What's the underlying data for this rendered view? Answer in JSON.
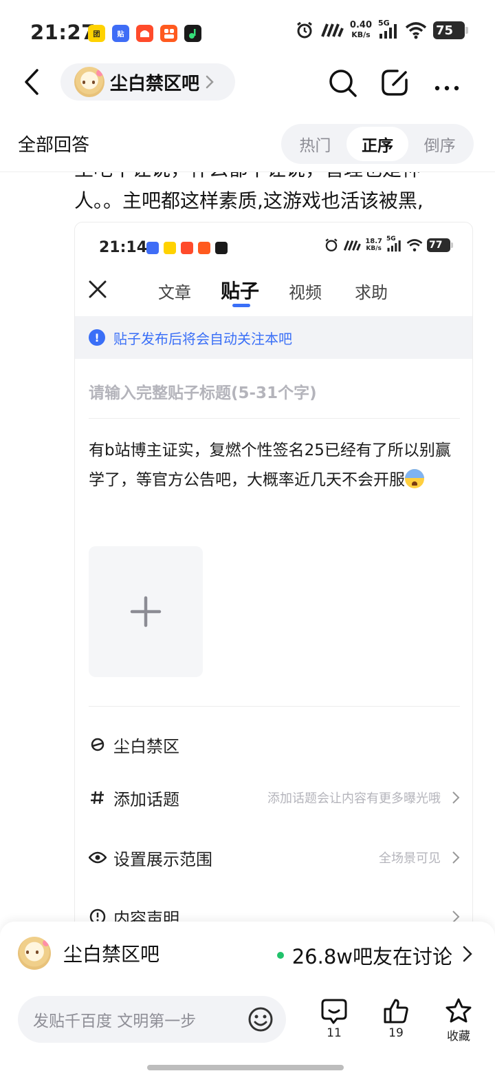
{
  "status_bar": {
    "time": "21:27",
    "net_speed_value": "0.40",
    "net_speed_unit": "KB/s",
    "network": "5G",
    "battery": "75",
    "apps": [
      {
        "name": "group-buy-app-icon",
        "color": "#ffd200",
        "glyph": "团"
      },
      {
        "name": "tieba-app-icon",
        "color": "#3f6df6",
        "glyph": "贴"
      },
      {
        "name": "shop-app-icon",
        "color": "#ff4b2b",
        "glyph": ""
      },
      {
        "name": "kuaishou-app-icon",
        "color": "#ff5a1f",
        "glyph": ""
      },
      {
        "name": "music-app-icon",
        "color": "#1a1a1a",
        "glyph": ""
      }
    ]
  },
  "nav": {
    "forum_name": "尘白禁区吧"
  },
  "answers": {
    "title": "全部回答",
    "sort_tabs": [
      "热门",
      "正序",
      "倒序"
    ],
    "active_sort": 1
  },
  "post": {
    "line_clipped": "主吧不让说，什么都不让说，管理也是神",
    "line_2": "人。。主吧都这样素质,这游戏也活该被黑,"
  },
  "embedded": {
    "status": {
      "time": "21:14",
      "net_speed_value": "18.7",
      "net_speed_unit": "KB/s",
      "network": "5G",
      "battery": "77"
    },
    "tabs": [
      "文章",
      "贴子",
      "视频",
      "求助"
    ],
    "active_tab": 1,
    "notice": "贴子发布后将会自动关注本吧",
    "title_placeholder": "请输入完整贴子标题(5-31个字)",
    "body": "有b站博主证实，复燃个性签名25已经有了所以别赢学了，等官方公告吧，大概率近几天不会开服",
    "rows": {
      "forum": "尘白禁区",
      "topic_label": "添加话题",
      "topic_hint": "添加话题会让内容有更多曝光哦",
      "visibility_label": "设置展示范围",
      "visibility_hint": "全场景可见",
      "statement_label": "内容声明"
    }
  },
  "forum_bar": {
    "name": "尘白禁区吧",
    "online": "26.8w吧友在讨论"
  },
  "comment_bar": {
    "placeholder": "发贴千百度 文明第一步",
    "comments": "11",
    "likes": "19",
    "favorite": "收藏"
  },
  "colors": {
    "accent_blue": "#3a6ff7",
    "online_green": "#21c26b",
    "pill_bg": "#f2f3f6"
  }
}
